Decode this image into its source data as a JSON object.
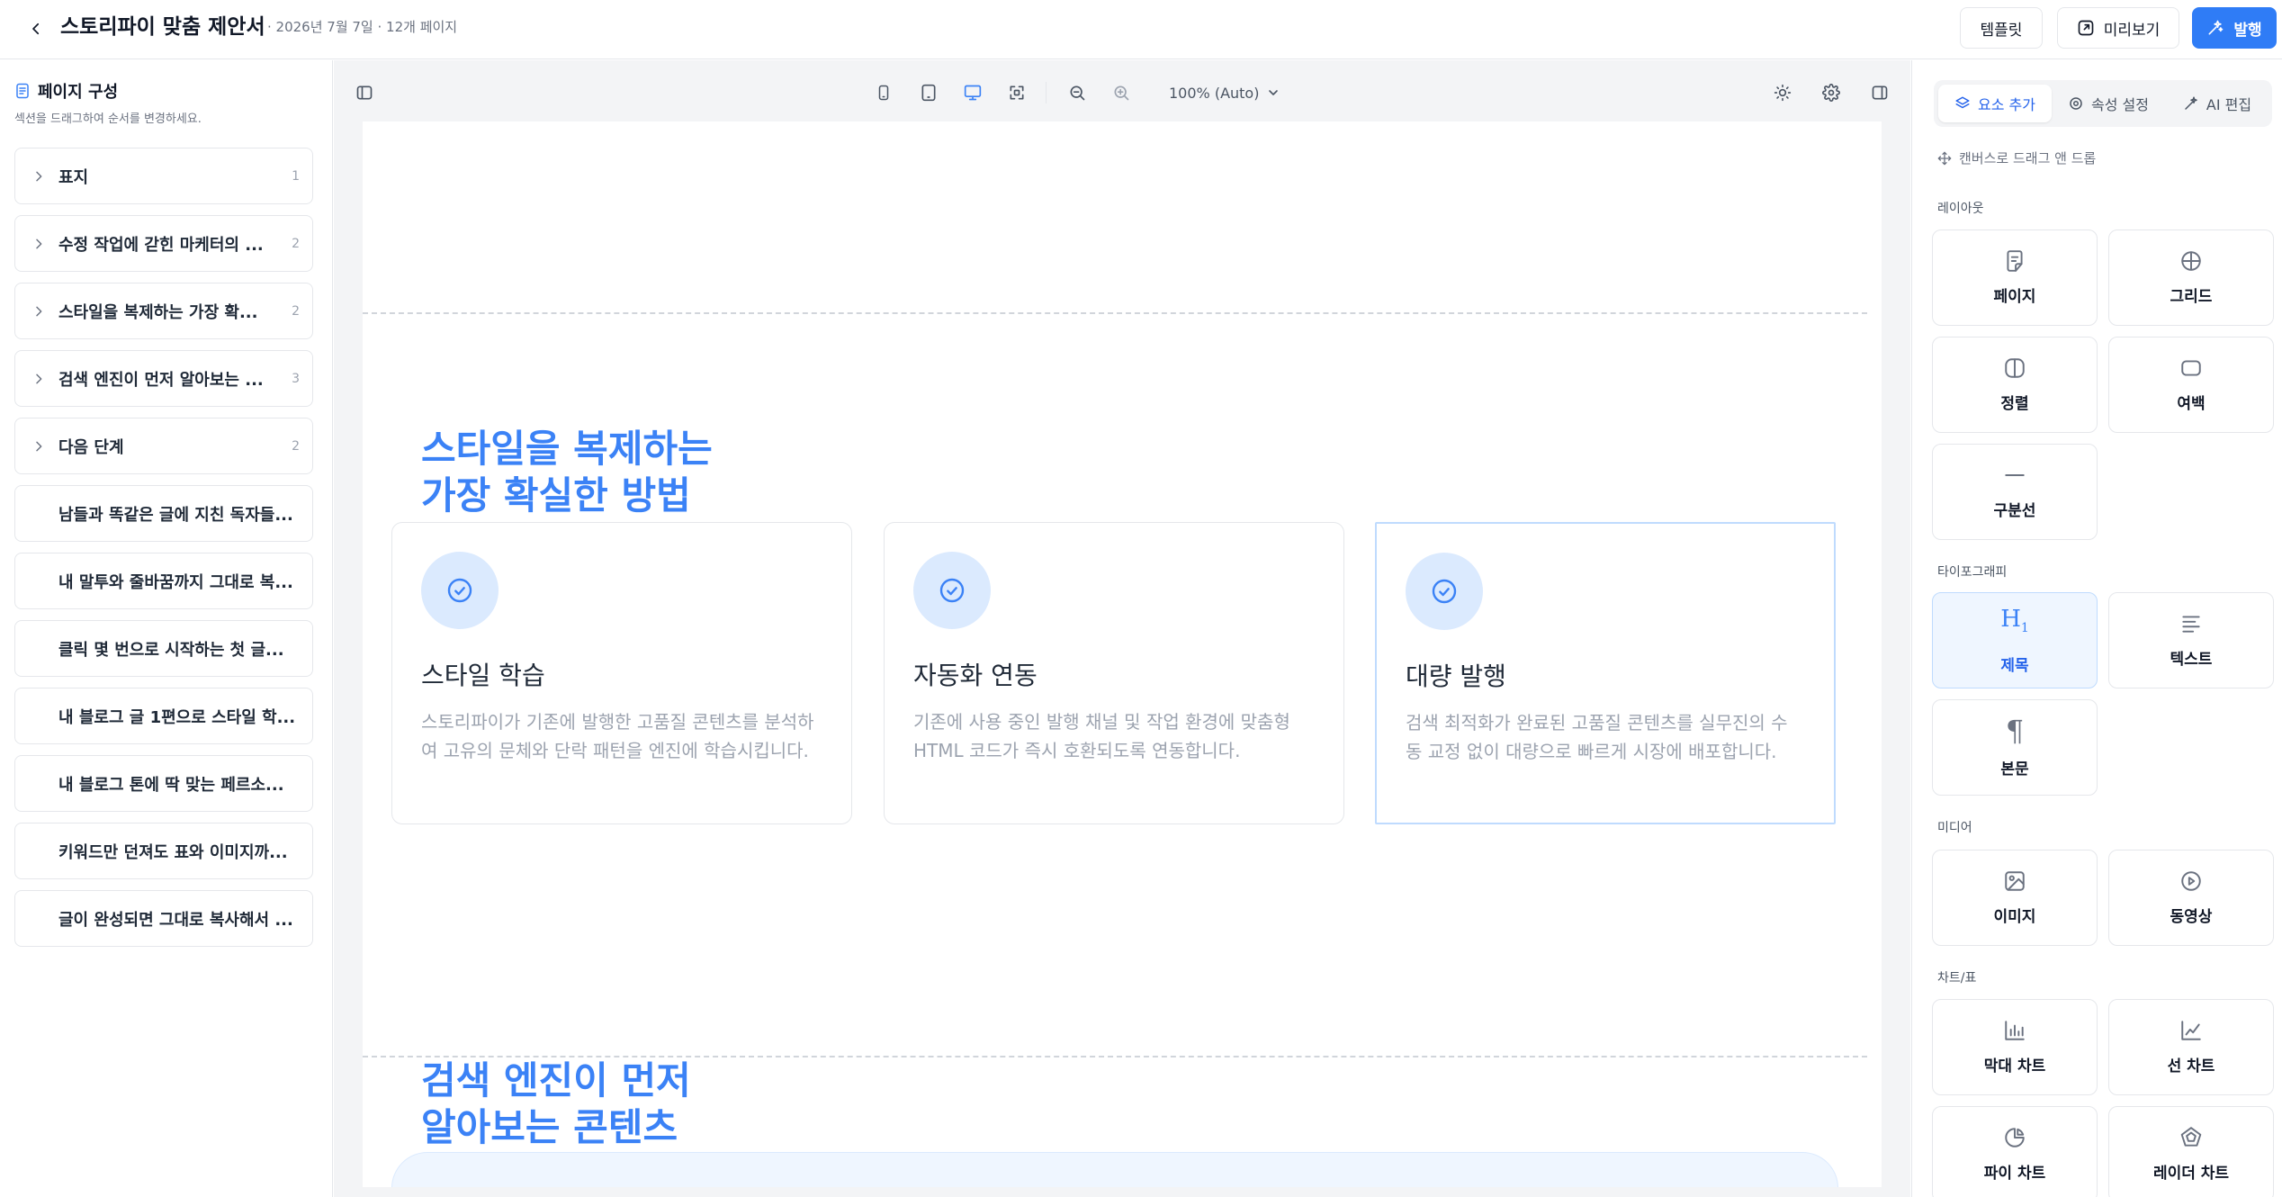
{
  "header": {
    "title": "스토리파이 맞춤 제안서",
    "meta": "· 2026년 7월 7일 · 12개 페이지",
    "template_label": "템플릿",
    "preview_label": "미리보기",
    "publish_label": "발행"
  },
  "sidebar": {
    "heading": "페이지 구성",
    "subtitle": "섹션을 드래그하여 순서를 변경하세요.",
    "sections": [
      {
        "label": "표지",
        "count": "1"
      },
      {
        "label": "수정 작업에 갇힌 마케터의 ...",
        "count": "2"
      },
      {
        "label": "스타일을 복제하는 가장 확...",
        "count": "2"
      },
      {
        "label": "검색 엔진이 먼저 알아보는 ...",
        "count": "3"
      },
      {
        "label": "다음 단계",
        "count": "2"
      }
    ],
    "pages": [
      "남들과 똑같은 글에 지친 독자들...",
      "내 말투와 줄바꿈까지 그대로 복...",
      "클릭 몇 번으로 시작하는 첫 글...",
      "내 블로그 글 1편으로 스타일 학...",
      "내 블로그 톤에 딱 맞는 페르소...",
      "키워드만 던져도 표와 이미지까...",
      "글이 완성되면 그대로 복사해서 ..."
    ]
  },
  "canvas": {
    "zoom": "100% (Auto)",
    "heading_1": [
      "스타일을 복제하는",
      "가장 확실한 방법"
    ],
    "cards": [
      {
        "title": "스타일 학습",
        "desc": "스토리파이가 기존에 발행한 고품질 콘텐츠를 분석하여 고유의 문체와 단락 패턴을 엔진에 학습시킵니다."
      },
      {
        "title": "자동화 연동",
        "desc": "기존에 사용 중인 발행 채널 및 작업 환경에 맞춤형 HTML 코드가 즉시 호환되도록 연동합니다."
      },
      {
        "title": "대량 발행",
        "desc": "검색 최적화가 완료된 고품질 콘텐츠를 실무진의 수동 교정 없이 대량으로 빠르게 시장에 배포합니다."
      }
    ],
    "heading_2": [
      "검색 엔진이 먼저",
      "알아보는 콘텐츠"
    ]
  },
  "panel": {
    "tabs": [
      "요소 추가",
      "속성 설정",
      "AI 편집"
    ],
    "hint": "캔버스로 드래그 앤 드롭",
    "groups": {
      "layout": "레이아웃",
      "typography": "타이포그래피",
      "media": "미디어",
      "charts": "차트/표"
    },
    "tiles": {
      "page": "페이지",
      "grid": "그리드",
      "align": "정렬",
      "spacing": "여백",
      "divider": "구분선",
      "heading": "제목",
      "text": "텍스트",
      "body": "본문",
      "image": "이미지",
      "video": "동영상",
      "bar_chart": "막대 차트",
      "line_chart": "선 차트",
      "pie_chart": "파이 차트",
      "radar_chart": "레이더 차트"
    }
  },
  "colors": {
    "accent": "#2f7cf6",
    "heading_blue": "#3b82f6"
  }
}
